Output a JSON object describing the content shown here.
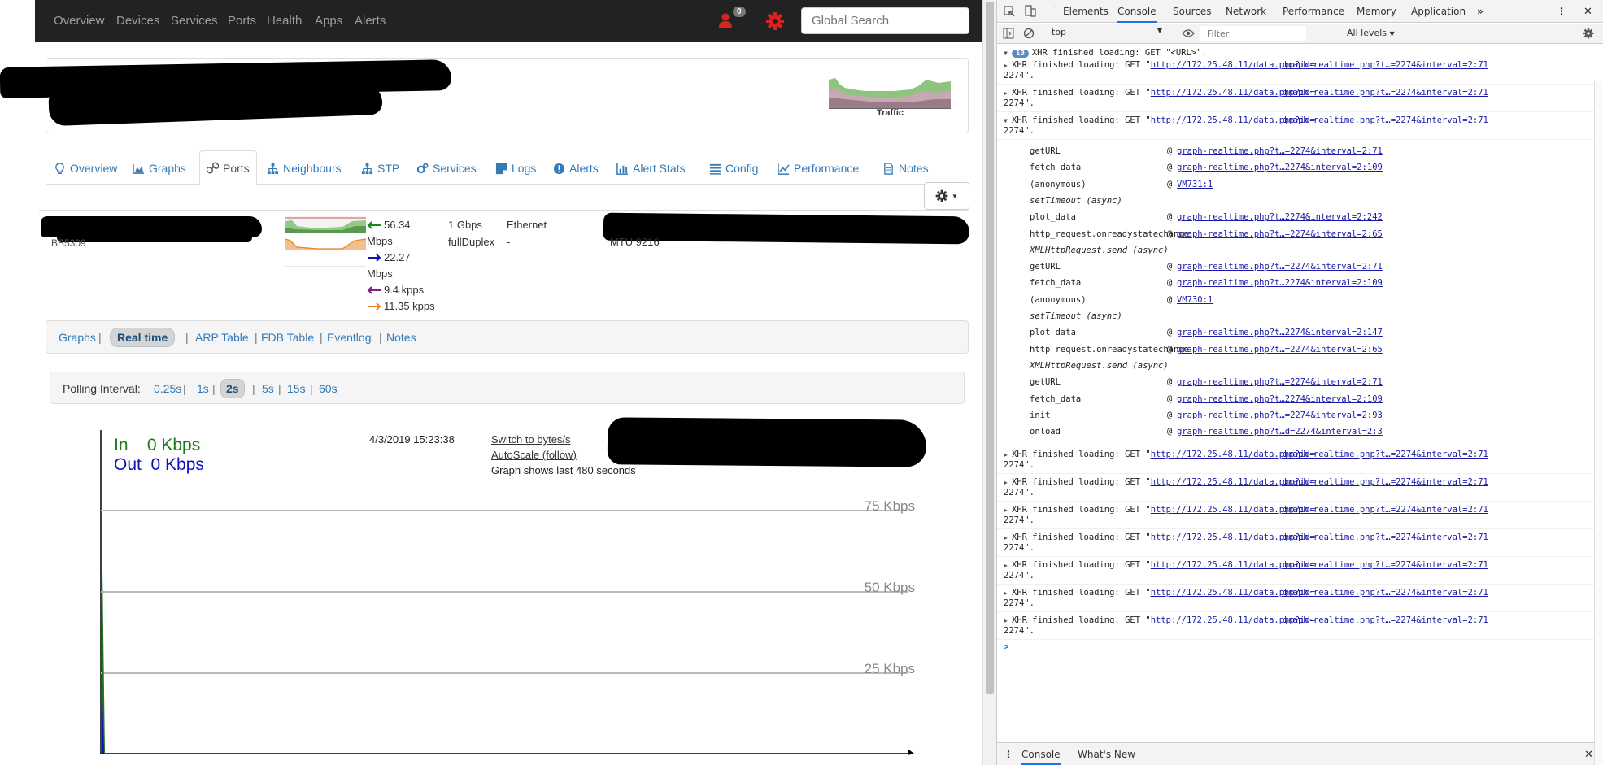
{
  "navbar": {
    "items": [
      "Overview",
      "Devices",
      "Services",
      "Ports",
      "Health",
      "Apps",
      "Alerts"
    ],
    "alert_count": "0",
    "search_placeholder": "Global Search"
  },
  "device": {
    "thumb_label": "Traffic"
  },
  "device_tabs": [
    "Overview",
    "Graphs",
    "Ports",
    "Neighbours",
    "STP",
    "Services",
    "Logs",
    "Alerts",
    "Alert Stats",
    "Config",
    "Performance",
    "Notes"
  ],
  "port": {
    "name_sub": "BB5309",
    "in_rate": "56.34",
    "in_unit": "Mbps",
    "out_rate": "22.27",
    "out_unit": "Mbps",
    "in_pps": "9.4 kpps",
    "out_pps": "11.35 kpps",
    "speed": "1 Gbps",
    "duplex": "fullDuplex",
    "type": "Ethernet",
    "type_sub": "-",
    "mtu": "MTU 9216"
  },
  "subtabs": [
    "Graphs",
    "Real time",
    "ARP Table",
    "FDB Table",
    "Eventlog",
    "Notes"
  ],
  "polling": {
    "label": "Polling Interval:",
    "options": [
      "0.25s",
      "1s",
      "2s",
      "5s",
      "15s",
      "60s"
    ],
    "selected": "2s"
  },
  "realtime": {
    "in_label": "In",
    "in_value": "0 Kbps",
    "out_label": "Out",
    "out_value": "0 Kbps",
    "timestamp": "4/3/2019 15:23:38",
    "switch_link": "Switch to bytes/s",
    "autoscale_link": "AutoScale (follow)",
    "note": "Graph shows last 480 seconds",
    "grid_labels": [
      "75 Kbps",
      "50 Kbps",
      "25 Kbps"
    ]
  },
  "devtools": {
    "tabs": [
      "Elements",
      "Console",
      "Sources",
      "Network",
      "Performance",
      "Memory",
      "Application"
    ],
    "active_tab": "Console",
    "context": "top",
    "filter_placeholder": "Filter",
    "levels": "All levels",
    "group_count": "10",
    "group_header": "XHR finished loading: GET \"<URL>\".",
    "xhr_prefix": "XHR finished loading: GET \"",
    "xhr_url": "http://172.25.48.11/data.php?id=",
    "xhr_src": "graph-realtime.php?t…=2274&interval=2:71",
    "xhr_cont": "2274\".",
    "stack": [
      {
        "fn": "getURL",
        "loc": "graph-realtime.php?t…=2274&interval=2:71"
      },
      {
        "fn": "fetch_data",
        "loc": "graph-realtime.php?t…2274&interval=2:109"
      },
      {
        "fn": "(anonymous)",
        "loc": "VM731:1"
      },
      {
        "async": "setTimeout (async)"
      },
      {
        "fn": "plot_data",
        "loc": "graph-realtime.php?t…2274&interval=2:242"
      },
      {
        "fn": "http_request.onreadystatechange",
        "loc": "graph-realtime.php?t…=2274&interval=2:65"
      },
      {
        "async": "XMLHttpRequest.send (async)"
      },
      {
        "fn": "getURL",
        "loc": "graph-realtime.php?t…=2274&interval=2:71"
      },
      {
        "fn": "fetch_data",
        "loc": "graph-realtime.php?t…2274&interval=2:109"
      },
      {
        "fn": "(anonymous)",
        "loc": "VM730:1"
      },
      {
        "async": "setTimeout (async)"
      },
      {
        "fn": "plot_data",
        "loc": "graph-realtime.php?t…2274&interval=2:147"
      },
      {
        "fn": "http_request.onreadystatechange",
        "loc": "graph-realtime.php?t…=2274&interval=2:65"
      },
      {
        "async": "XMLHttpRequest.send (async)"
      },
      {
        "fn": "getURL",
        "loc": "graph-realtime.php?t…=2274&interval=2:71"
      },
      {
        "fn": "fetch_data",
        "loc": "graph-realtime.php?t…2274&interval=2:109"
      },
      {
        "fn": "init",
        "loc": "graph-realtime.php?t…=2274&interval=2:93"
      },
      {
        "fn": "onload",
        "loc": "graph-realtime.php?t…d=2274&interval=2:3"
      }
    ],
    "prompt": ">",
    "drawer_tabs": [
      "Console",
      "What's New"
    ]
  },
  "colors": {
    "navbar_bg": "#222222",
    "link": "#337ab7",
    "in_green": "#1a7a1a",
    "out_blue": "#1010c0",
    "alert_red": "#d9231e"
  }
}
